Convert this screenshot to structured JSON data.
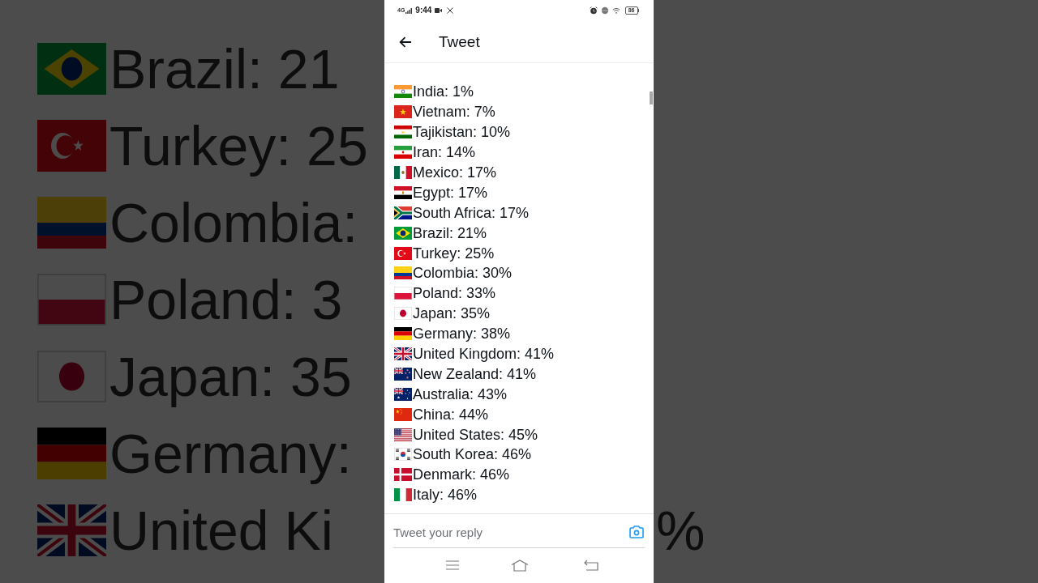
{
  "backdrop": {
    "left_rows": [
      {
        "kind": "br",
        "text": "Brazil: 21"
      },
      {
        "kind": "tr",
        "text": "Turkey: 25"
      },
      {
        "kind": "co",
        "text": "Colombia:"
      },
      {
        "kind": "pl",
        "text": "Poland: 3"
      },
      {
        "kind": "jp",
        "text": "Japan: 35"
      },
      {
        "kind": "de",
        "text": "Germany:"
      },
      {
        "kind": "gb",
        "text": "United Ki"
      }
    ],
    "right_text": "%"
  },
  "status_bar": {
    "network": "4G",
    "time": "9:44",
    "battery": "86"
  },
  "header": {
    "title": "Tweet"
  },
  "tweet": {
    "lines": [
      {
        "kind": "in",
        "text": "India: 1%"
      },
      {
        "kind": "vn",
        "text": "Vietnam: 7%"
      },
      {
        "kind": "tj",
        "text": "Tajikistan: 10%"
      },
      {
        "kind": "ir",
        "text": "Iran: 14%"
      },
      {
        "kind": "mx",
        "text": "Mexico: 17%"
      },
      {
        "kind": "eg",
        "text": "Egypt: 17%"
      },
      {
        "kind": "za",
        "text": "South Africa: 17%"
      },
      {
        "kind": "br",
        "text": "Brazil: 21%"
      },
      {
        "kind": "tr",
        "text": "Turkey: 25%"
      },
      {
        "kind": "co",
        "text": "Colombia: 30%"
      },
      {
        "kind": "pl",
        "text": "Poland: 33%"
      },
      {
        "kind": "jp",
        "text": "Japan: 35%"
      },
      {
        "kind": "de",
        "text": "Germany: 38%"
      },
      {
        "kind": "gb",
        "text": "United Kingdom: 41%"
      },
      {
        "kind": "nz",
        "text": "New Zealand: 41%"
      },
      {
        "kind": "au",
        "text": "Australia: 43%"
      },
      {
        "kind": "cn",
        "text": "China: 44%"
      },
      {
        "kind": "us",
        "text": "United States: 45%"
      },
      {
        "kind": "kr",
        "text": "South Korea: 46%"
      },
      {
        "kind": "dk",
        "text": "Denmark: 46%"
      },
      {
        "kind": "it",
        "text": "Italy: 46%"
      }
    ]
  },
  "reply": {
    "placeholder": "Tweet your reply"
  }
}
